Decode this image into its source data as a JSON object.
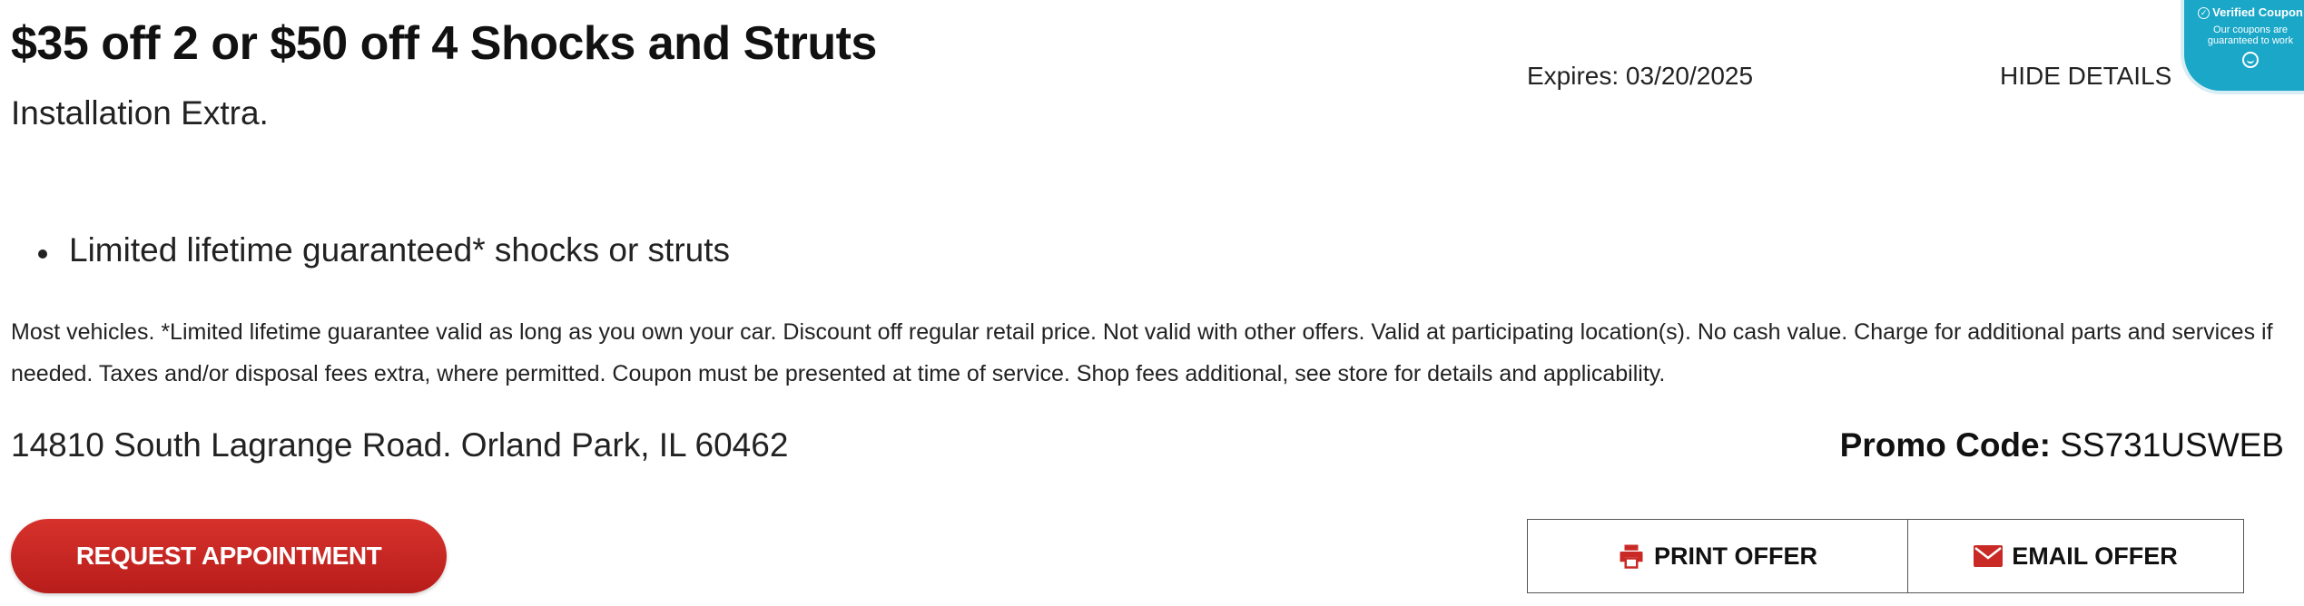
{
  "coupon": {
    "title": "$35 off 2 or $50 off 4 Shocks and Struts",
    "subtitle": "Installation Extra.",
    "expires": "Expires: 03/20/2025",
    "hide_details_label": "HIDE DETAILS",
    "bullets": [
      "Limited lifetime guaranteed* shocks or struts"
    ],
    "disclaimer": "Most vehicles. *Limited lifetime guarantee valid as long as you own your car. Discount off regular retail price. Not valid with other offers. Valid at participating location(s). No cash value. Charge for additional parts and services if needed. Taxes and/or disposal fees extra, where permitted. Coupon must be presented at time of service. Shop fees additional, see store for details and applicability.",
    "address": "14810 South Lagrange Road. Orland Park, IL 60462",
    "promo_label": "Promo Code:",
    "promo_code": "SS731USWEB"
  },
  "badge": {
    "title": "Verified Coupon",
    "subtitle": "Our coupons are guaranteed to work",
    "icons": [
      "check-circle-icon",
      "smile-icon"
    ]
  },
  "actions": {
    "request_label": "REQUEST APPOINTMENT",
    "print_label": "PRINT OFFER",
    "email_label": "EMAIL OFFER",
    "icons": [
      "printer-icon",
      "envelope-icon"
    ]
  },
  "colors": {
    "accent_red": "#c92a25",
    "badge_blue": "#1aa7c8"
  }
}
